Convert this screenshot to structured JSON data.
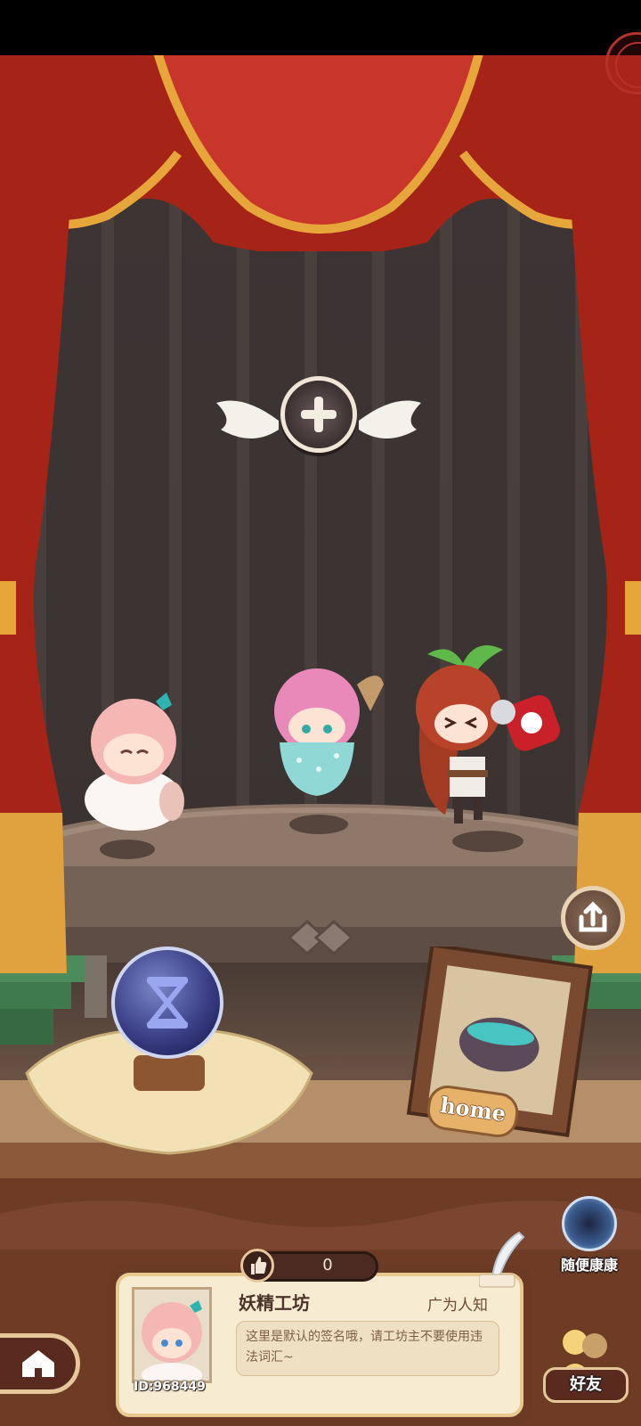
{
  "stage": {
    "add_slot_icon": "plus-icon",
    "home_sign": "home"
  },
  "characters": [
    {
      "name": "sheep-fairy",
      "icon": "pink-hair-sheep-chibi"
    },
    {
      "name": "teacup-fairy",
      "icon": "pink-hair-teacup-chibi"
    },
    {
      "name": "tomato-fairy",
      "icon": "red-hair-tomato-chibi"
    }
  ],
  "side_buttons": {
    "casual_label": "随便康康",
    "friends_label": "好友"
  },
  "profile": {
    "likes": "0",
    "workshop_name": "妖精工坊",
    "fame": "广为人知",
    "signature": "这里是默认的签名哦，请工坊主不要使用违法词汇~",
    "id": "ID:968449"
  },
  "colors": {
    "curtain": "#b52a1c",
    "gold_trim": "#e6a63a",
    "card_bg": "#f7ebd2",
    "card_border": "#6a3a25"
  }
}
